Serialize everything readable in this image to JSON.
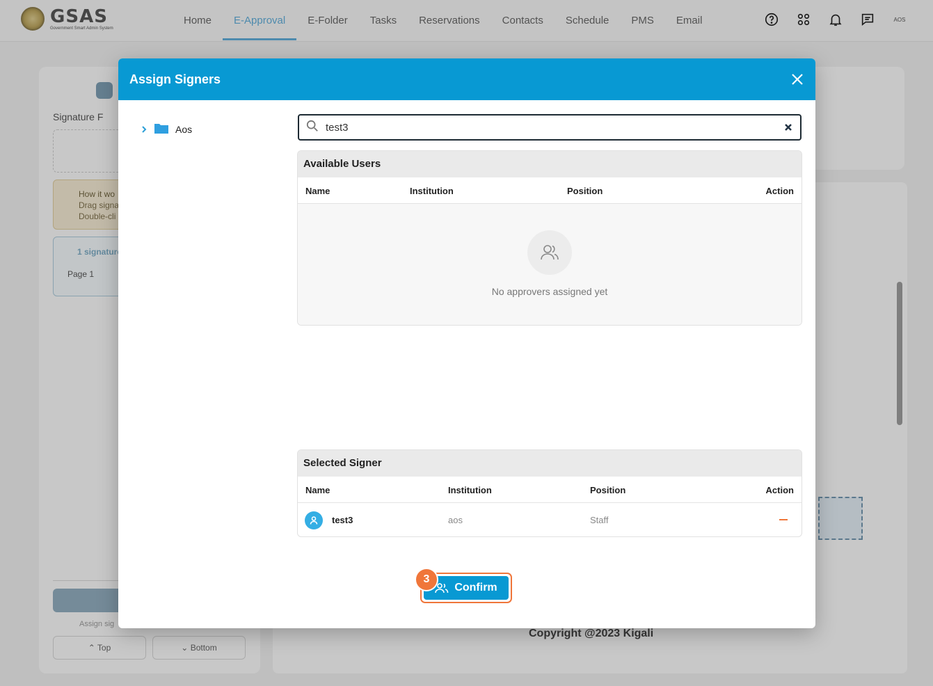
{
  "app": {
    "logo_name": "GSAS",
    "logo_subtitle": "Government Smart Admin System"
  },
  "nav": {
    "items": [
      "Home",
      "E-Approval",
      "E-Folder",
      "Tasks",
      "Reservations",
      "Contacts",
      "Schedule",
      "PMS",
      "Email"
    ],
    "active": "E-Approval",
    "user": "AOS"
  },
  "background": {
    "signature_title": "Signature F",
    "how_title": "How it wo",
    "how_line1": "Drag signa",
    "how_line2": "Double-cli",
    "signature_status": "1 signature",
    "page_label": "Page 1",
    "assign_hint": "Assign sig",
    "top_button": "Top",
    "bottom_button": "Bottom",
    "copyright": "Copyright @2023 Kigali"
  },
  "modal": {
    "title": "Assign Signers",
    "tree": {
      "root": "Aos"
    },
    "search": {
      "value": "test3"
    },
    "available": {
      "title": "Available Users",
      "columns": [
        "Name",
        "Institution",
        "Position",
        "Action"
      ],
      "empty_text": "No approvers assigned yet"
    },
    "selected": {
      "title": "Selected Signer",
      "columns": [
        "Name",
        "Institution",
        "Position",
        "Action"
      ],
      "rows": [
        {
          "name": "test3",
          "institution": "aos",
          "position": "Staff"
        }
      ]
    },
    "confirm_label": "Confirm",
    "step_badge": "3"
  },
  "colors": {
    "header_blue": "#0899d3",
    "highlight_orange": "#f0763a"
  }
}
